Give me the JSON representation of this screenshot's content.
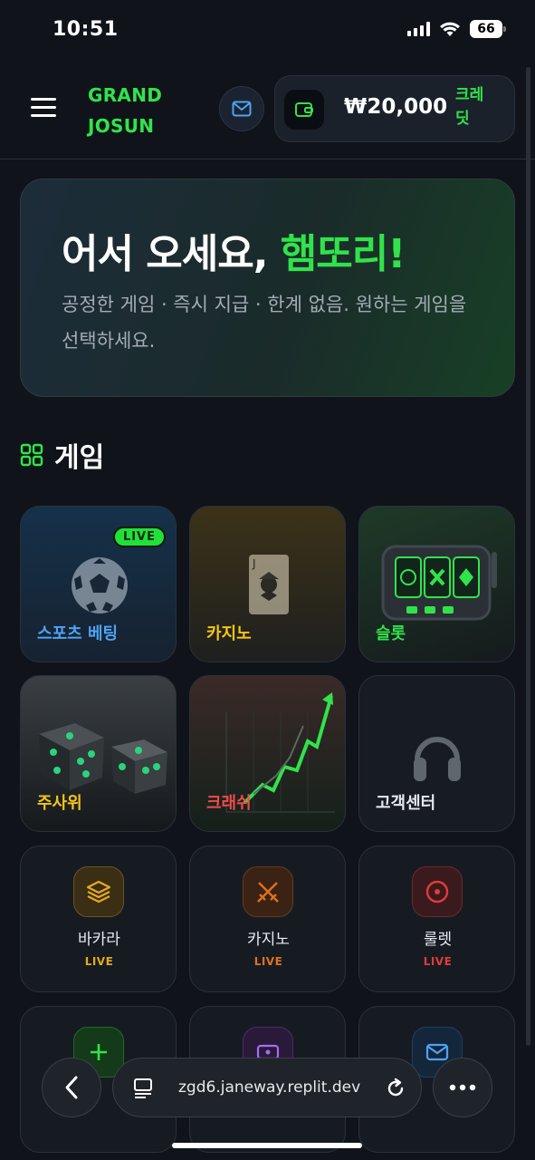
{
  "status": {
    "time": "10:51",
    "battery": "66"
  },
  "header": {
    "logo_line1": "GRAND",
    "logo_line2": "JOSUN",
    "balance": "₩20,000",
    "credit_label": "크레딧"
  },
  "hero": {
    "title_prefix": "어서 오세요, ",
    "title_name": "햄또리!",
    "subtitle": "공정한 게임 · 즉시 지급 · 한계 없음. 원하는 게임을 선택하세요."
  },
  "games_section": {
    "title": "게임"
  },
  "cards": [
    {
      "label": "스포츠 베팅",
      "badge": "LIVE",
      "color": "#4ea3f5",
      "icon": "soccer-ball"
    },
    {
      "label": "카지노",
      "color": "#f5c518",
      "icon": "joker-card"
    },
    {
      "label": "슬롯",
      "color": "#31e34a",
      "icon": "slot-machine"
    },
    {
      "label": "주사위",
      "color": "#f5c518",
      "icon": "dice"
    },
    {
      "label": "크래쉬",
      "color": "#f04b4b",
      "icon": "crash-chart"
    },
    {
      "label": "고객센터",
      "color": "#e6e9ee",
      "icon": "headphones"
    }
  ],
  "mini_cards": [
    {
      "label": "바카라",
      "live": "LIVE",
      "color": "#e6a91e",
      "icon": "layers-icon"
    },
    {
      "label": "카지노",
      "live": "LIVE",
      "color": "#e0701e",
      "icon": "swords-icon"
    },
    {
      "label": "룰렛",
      "live": "LIVE",
      "color": "#e03b3b",
      "icon": "target-icon"
    }
  ],
  "browser": {
    "url": "zgd6.janeway.replit.dev"
  }
}
